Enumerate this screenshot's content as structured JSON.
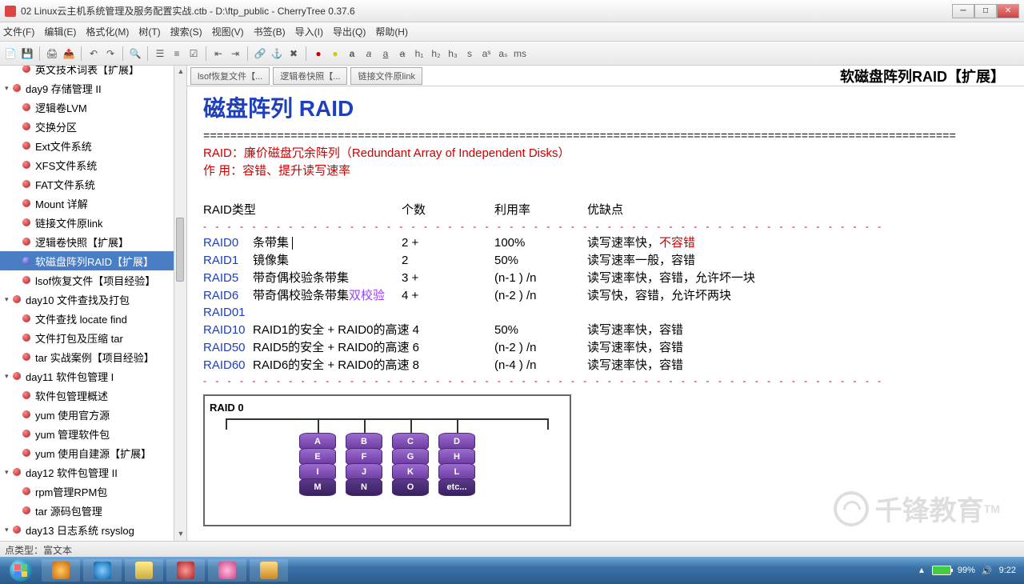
{
  "window": {
    "title": "02 Linux云主机系统管理及服务配置实战.ctb - D:\\ftp_public - CherryTree 0.37.6"
  },
  "menus": [
    "文件(F)",
    "编辑(E)",
    "格式化(M)",
    "树(T)",
    "搜索(S)",
    "视图(V)",
    "书签(B)",
    "导入(I)",
    "导出(Q)",
    "帮助(H)"
  ],
  "toolbar_font_sample": "ms",
  "sidebar": {
    "items": [
      {
        "label": "英文技术词表【扩展】",
        "depth": 1,
        "partial": true
      },
      {
        "label": "day9 存储管理 II",
        "depth": 0,
        "expandable": true
      },
      {
        "label": "逻辑卷LVM",
        "depth": 1
      },
      {
        "label": "交换分区",
        "depth": 1
      },
      {
        "label": "Ext文件系统",
        "depth": 1
      },
      {
        "label": "XFS文件系统",
        "depth": 1
      },
      {
        "label": "FAT文件系统",
        "depth": 1
      },
      {
        "label": "Mount 详解",
        "depth": 1
      },
      {
        "label": "链接文件原link",
        "depth": 1
      },
      {
        "label": "逻辑卷快照【扩展】",
        "depth": 1
      },
      {
        "label": "软磁盘阵列RAID【扩展】",
        "depth": 1,
        "selected": true
      },
      {
        "label": "lsof恢复文件【项目经验】",
        "depth": 1
      },
      {
        "label": "day10 文件查找及打包",
        "depth": 0,
        "expandable": true
      },
      {
        "label": "文件查找 locate find",
        "depth": 1
      },
      {
        "label": "文件打包及压缩 tar",
        "depth": 1
      },
      {
        "label": "tar 实战案例【项目经验】",
        "depth": 1
      },
      {
        "label": "day11 软件包管理 I",
        "depth": 0,
        "expandable": true
      },
      {
        "label": "软件包管理概述",
        "depth": 1
      },
      {
        "label": "yum 使用官方源",
        "depth": 1
      },
      {
        "label": "yum 管理软件包",
        "depth": 1
      },
      {
        "label": "yum 使用自建源【扩展】",
        "depth": 1
      },
      {
        "label": "day12 软件包管理 II",
        "depth": 0,
        "expandable": true
      },
      {
        "label": "rpm管理RPM包",
        "depth": 1
      },
      {
        "label": "tar 源码包管理",
        "depth": 1
      },
      {
        "label": "day13 日志系统 rsyslog",
        "depth": 0,
        "expandable": true
      }
    ]
  },
  "tabs": [
    "lsof恢复文件【...",
    "逻辑卷快照【...",
    "链接文件原link"
  ],
  "page_heading": "软磁盘阵列RAID【扩展】",
  "doc": {
    "title": "磁盘阵列 RAID",
    "def_label": "RAID：",
    "def_text": "廉价磁盘冗余阵列（Redundant Array of Independent Disks）",
    "use_label": "作 用：",
    "use_text": "容错、提升读写速率",
    "headers": {
      "type": "RAID类型",
      "count": "个数",
      "util": "利用率",
      "pros": "优缺点"
    },
    "rows": [
      {
        "t": "RAID0",
        "d": "条带集",
        "n": "2 +",
        "u": "100%",
        "a": "读写速率快，",
        "a2": "不容错",
        "a2red": true,
        "cursor": true
      },
      {
        "t": "RAID1",
        "d": "镜像集",
        "n": "2",
        "u": "50%",
        "a": "读写速率一般，容错"
      },
      {
        "t": "RAID5",
        "d": "带奇偶校验条带集",
        "n": "3 +",
        "u": "(n-1 ) /n",
        "a": "读写速率快，容错，允许坏一块"
      },
      {
        "t": "RAID6",
        "d": "带奇偶校验条带集",
        "d2": "双校验",
        "n": "4 +",
        "u": "(n-2 ) /n",
        "a": "读写快，容错，允许坏两块"
      },
      {
        "t": "RAID01",
        "d": "",
        "n": "",
        "u": "",
        "a": ""
      },
      {
        "t": "RAID10",
        "d": "RAID1的安全 + RAID0的高速 4",
        "dwide": true,
        "u": "50%",
        "a": "读写速率快，容错"
      },
      {
        "t": "RAID50",
        "d": "RAID5的安全 + RAID0的高速 6",
        "dwide": true,
        "u": "(n-2 ) /n",
        "a": "读写速率快，容错"
      },
      {
        "t": "RAID60",
        "d": "RAID6的安全 + RAID0的高速 8",
        "dwide": true,
        "u": "(n-4 ) /n",
        "a": "读写速率快，容错"
      }
    ],
    "raid_box": {
      "title": "RAID 0",
      "disks": [
        [
          "A",
          "E",
          "I",
          "M"
        ],
        [
          "B",
          "F",
          "J",
          "N"
        ],
        [
          "C",
          "G",
          "K",
          "O"
        ],
        [
          "D",
          "H",
          "L",
          "etc..."
        ]
      ]
    }
  },
  "watermark": {
    "text": "千锋教育",
    "tm": "TM"
  },
  "status": "点类型：富文本",
  "tray": {
    "battery": "99%",
    "time": "9:22"
  }
}
